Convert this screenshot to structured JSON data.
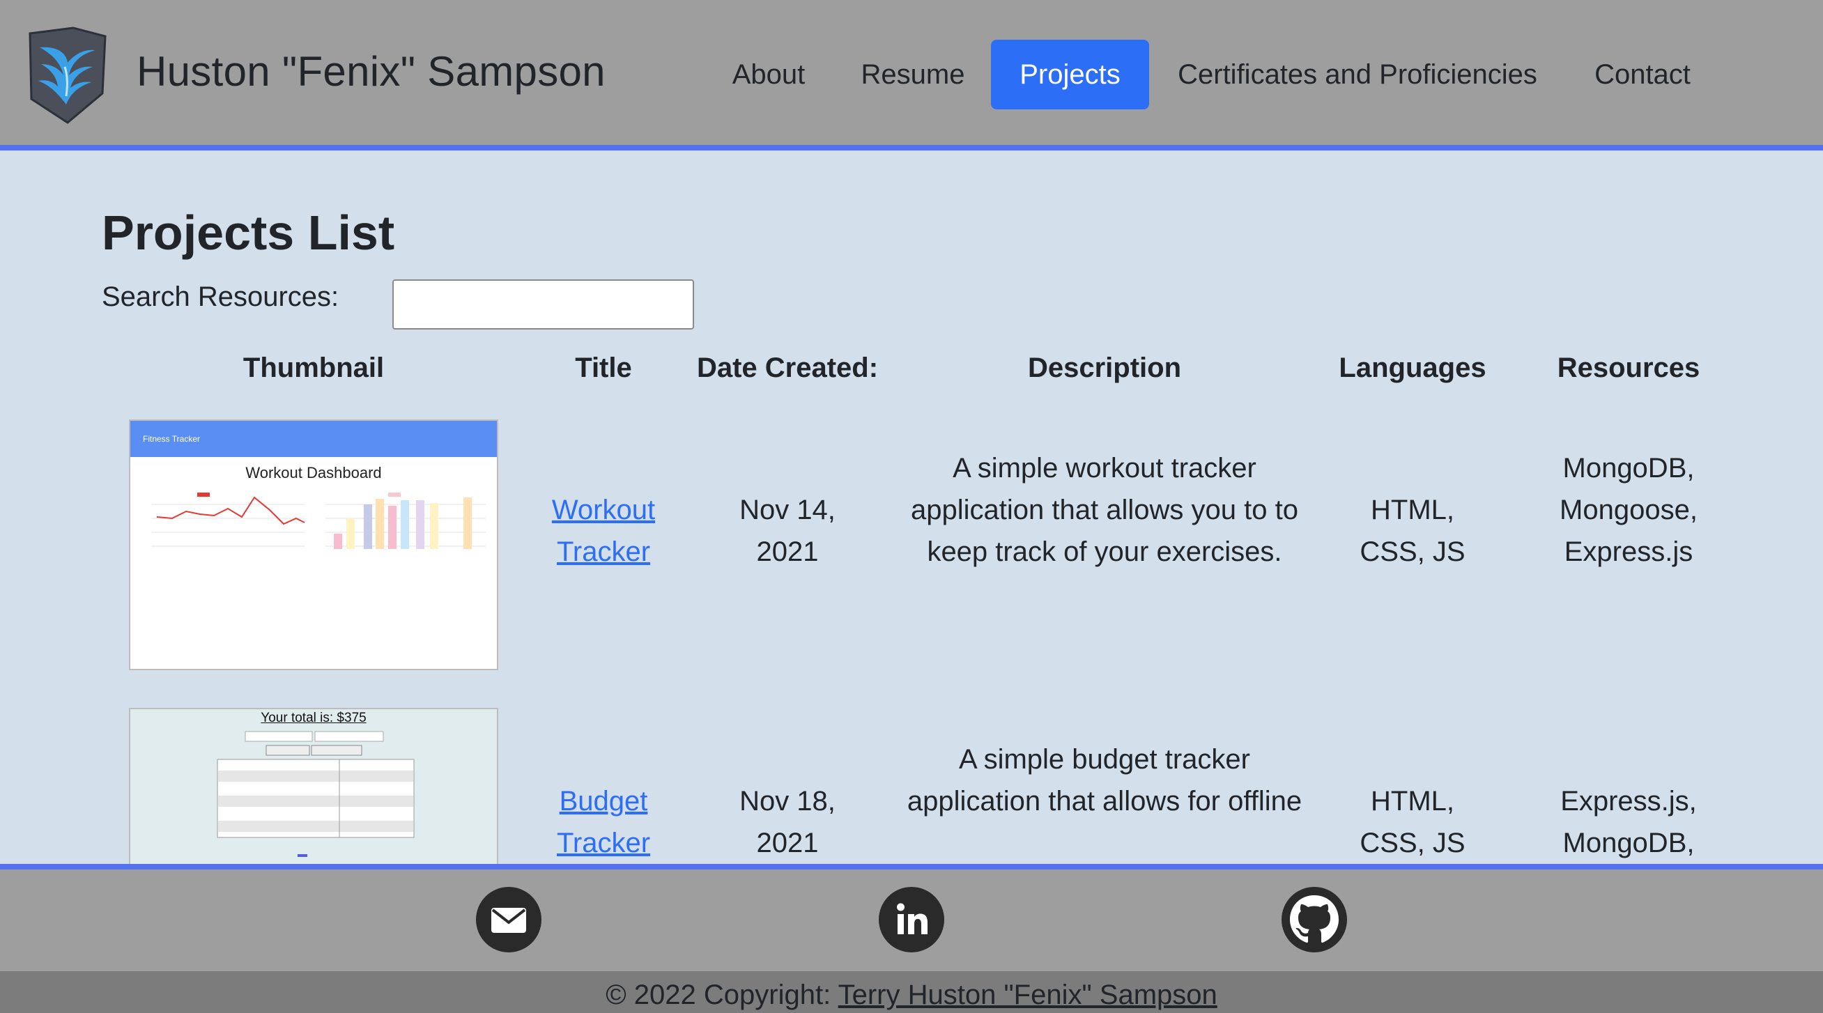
{
  "header": {
    "brand": "Huston \"Fenix\" Sampson",
    "nav": [
      {
        "label": "About",
        "active": false
      },
      {
        "label": "Resume",
        "active": false
      },
      {
        "label": "Projects",
        "active": true
      },
      {
        "label": "Certificates and Proficiencies",
        "active": false
      },
      {
        "label": "Contact",
        "active": false
      }
    ],
    "logo_icon": "phoenix-shield-icon"
  },
  "main": {
    "title": "Projects List",
    "search": {
      "label": "Search Resources:",
      "value": "",
      "placeholder": ""
    },
    "table": {
      "columns": [
        "Thumbnail",
        "Title",
        "Date Created:",
        "Description",
        "Languages",
        "Resources"
      ],
      "rows": [
        {
          "thumbnail_caption": "Workout Dashboard",
          "thumbnail_header": "Fitness Tracker",
          "title_line1": "Workout",
          "title_line2": "Tracker",
          "date_line1": "Nov 14,",
          "date_line2": "2021",
          "description_lines": [
            "A simple workout tracker",
            "application that allows you to to",
            "keep track of your exercises."
          ],
          "languages_lines": [
            "HTML,",
            "CSS, JS"
          ],
          "resources_lines": [
            "MongoDB,",
            "Mongoose,",
            "Express.js"
          ]
        },
        {
          "thumbnail_caption": "Your total is: $375",
          "title_line1": "Budget",
          "title_line2": "Tracker",
          "date_line1": "Nov 18,",
          "date_line2": "2021",
          "description_lines": [
            "A simple budget tracker",
            "application that allows for offline"
          ],
          "languages_lines": [
            "HTML,",
            "CSS, JS"
          ],
          "resources_lines": [
            "Express.js,",
            "MongoDB,"
          ]
        }
      ]
    }
  },
  "footer": {
    "social": [
      {
        "icon": "email-icon"
      },
      {
        "icon": "linkedin-icon"
      },
      {
        "icon": "github-icon"
      }
    ],
    "copyright_prefix": "© 2022 Copyright:",
    "copyright_name": "Terry Huston \"Fenix\" Sampson"
  },
  "colors": {
    "header_bg": "#9f9e9f",
    "accent": "#5472f0",
    "active_nav": "#2d6ef6",
    "page_bg": "#d4dfec",
    "link": "#2d6ef6"
  }
}
